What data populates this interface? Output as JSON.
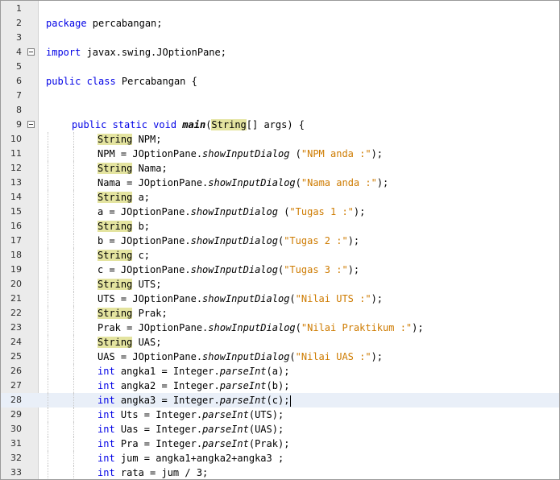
{
  "editor": {
    "lines": [
      {
        "no": "1",
        "fold": false,
        "indent": 0,
        "tokens": []
      },
      {
        "no": "2",
        "fold": false,
        "indent": 0,
        "tokens": [
          {
            "t": "package",
            "c": "kw"
          },
          {
            "t": " percabangan;",
            "c": ""
          }
        ]
      },
      {
        "no": "3",
        "fold": false,
        "indent": 0,
        "tokens": []
      },
      {
        "no": "4",
        "fold": true,
        "indent": 0,
        "tokens": [
          {
            "t": "import",
            "c": "kw"
          },
          {
            "t": " javax.swing.JOptionPane;",
            "c": ""
          }
        ]
      },
      {
        "no": "5",
        "fold": false,
        "indent": 0,
        "tokens": []
      },
      {
        "no": "6",
        "fold": false,
        "indent": 0,
        "tokens": [
          {
            "t": "public class",
            "c": "kw"
          },
          {
            "t": " Percabangan {",
            "c": ""
          }
        ]
      },
      {
        "no": "7",
        "fold": false,
        "indent": 0,
        "tokens": []
      },
      {
        "no": "8",
        "fold": false,
        "indent": 0,
        "tokens": []
      },
      {
        "no": "9",
        "fold": true,
        "indent": 1,
        "tokens": [
          {
            "t": "public static void",
            "c": "kw"
          },
          {
            "t": " ",
            "c": ""
          },
          {
            "t": "main",
            "c": "bi"
          },
          {
            "t": "(",
            "c": ""
          },
          {
            "t": "String",
            "c": "hl-type"
          },
          {
            "t": "[] args) {",
            "c": ""
          }
        ]
      },
      {
        "no": "10",
        "fold": false,
        "indent": 2,
        "tokens": [
          {
            "t": "String",
            "c": "hl-type"
          },
          {
            "t": " NPM;",
            "c": ""
          }
        ]
      },
      {
        "no": "11",
        "fold": false,
        "indent": 2,
        "tokens": [
          {
            "t": "NPM = JOptionPane.",
            "c": ""
          },
          {
            "t": "showInputDialog",
            "c": "it"
          },
          {
            "t": " (",
            "c": ""
          },
          {
            "t": "\"NPM anda :\"",
            "c": "str"
          },
          {
            "t": ");",
            "c": ""
          }
        ]
      },
      {
        "no": "12",
        "fold": false,
        "indent": 2,
        "tokens": [
          {
            "t": "String",
            "c": "hl-type"
          },
          {
            "t": " Nama;",
            "c": ""
          }
        ]
      },
      {
        "no": "13",
        "fold": false,
        "indent": 2,
        "tokens": [
          {
            "t": "Nama = JOptionPane.",
            "c": ""
          },
          {
            "t": "showInputDialog",
            "c": "it"
          },
          {
            "t": "(",
            "c": ""
          },
          {
            "t": "\"Nama anda :\"",
            "c": "str"
          },
          {
            "t": ");",
            "c": ""
          }
        ]
      },
      {
        "no": "14",
        "fold": false,
        "indent": 2,
        "tokens": [
          {
            "t": "String",
            "c": "hl-type"
          },
          {
            "t": " a;",
            "c": ""
          }
        ]
      },
      {
        "no": "15",
        "fold": false,
        "indent": 2,
        "tokens": [
          {
            "t": "a = JOptionPane.",
            "c": ""
          },
          {
            "t": "showInputDialog",
            "c": "it"
          },
          {
            "t": " (",
            "c": ""
          },
          {
            "t": "\"Tugas 1 :\"",
            "c": "str"
          },
          {
            "t": ");",
            "c": ""
          }
        ]
      },
      {
        "no": "16",
        "fold": false,
        "indent": 2,
        "tokens": [
          {
            "t": "String",
            "c": "hl-type"
          },
          {
            "t": " b;",
            "c": ""
          }
        ]
      },
      {
        "no": "17",
        "fold": false,
        "indent": 2,
        "tokens": [
          {
            "t": "b = JOptionPane.",
            "c": ""
          },
          {
            "t": "showInputDialog",
            "c": "it"
          },
          {
            "t": "(",
            "c": ""
          },
          {
            "t": "\"Tugas 2 :\"",
            "c": "str"
          },
          {
            "t": ");",
            "c": ""
          }
        ]
      },
      {
        "no": "18",
        "fold": false,
        "indent": 2,
        "tokens": [
          {
            "t": "String",
            "c": "hl-type"
          },
          {
            "t": " c;",
            "c": ""
          }
        ]
      },
      {
        "no": "19",
        "fold": false,
        "indent": 2,
        "tokens": [
          {
            "t": "c = JOptionPane.",
            "c": ""
          },
          {
            "t": "showInputDialog",
            "c": "it"
          },
          {
            "t": "(",
            "c": ""
          },
          {
            "t": "\"Tugas 3 :\"",
            "c": "str"
          },
          {
            "t": ");",
            "c": ""
          }
        ]
      },
      {
        "no": "20",
        "fold": false,
        "indent": 2,
        "tokens": [
          {
            "t": "String",
            "c": "hl-type"
          },
          {
            "t": " UTS;",
            "c": ""
          }
        ]
      },
      {
        "no": "21",
        "fold": false,
        "indent": 2,
        "tokens": [
          {
            "t": "UTS = JOptionPane.",
            "c": ""
          },
          {
            "t": "showInputDialog",
            "c": "it"
          },
          {
            "t": "(",
            "c": ""
          },
          {
            "t": "\"Nilai UTS :\"",
            "c": "str"
          },
          {
            "t": ");",
            "c": ""
          }
        ]
      },
      {
        "no": "22",
        "fold": false,
        "indent": 2,
        "tokens": [
          {
            "t": "String",
            "c": "hl-type"
          },
          {
            "t": " Prak;",
            "c": ""
          }
        ]
      },
      {
        "no": "23",
        "fold": false,
        "indent": 2,
        "tokens": [
          {
            "t": "Prak = JOptionPane.",
            "c": ""
          },
          {
            "t": "showInputDialog",
            "c": "it"
          },
          {
            "t": "(",
            "c": ""
          },
          {
            "t": "\"Nilai Praktikum :\"",
            "c": "str"
          },
          {
            "t": ");",
            "c": ""
          }
        ]
      },
      {
        "no": "24",
        "fold": false,
        "indent": 2,
        "tokens": [
          {
            "t": "String",
            "c": "hl-type"
          },
          {
            "t": " UAS;",
            "c": ""
          }
        ]
      },
      {
        "no": "25",
        "fold": false,
        "indent": 2,
        "tokens": [
          {
            "t": "UAS = JOptionPane.",
            "c": ""
          },
          {
            "t": "showInputDialog",
            "c": "it"
          },
          {
            "t": "(",
            "c": ""
          },
          {
            "t": "\"Nilai UAS :\"",
            "c": "str"
          },
          {
            "t": ");",
            "c": ""
          }
        ]
      },
      {
        "no": "26",
        "fold": false,
        "indent": 2,
        "tokens": [
          {
            "t": "int",
            "c": "kw"
          },
          {
            "t": " angka1 = Integer.",
            "c": ""
          },
          {
            "t": "parseInt",
            "c": "it"
          },
          {
            "t": "(a);",
            "c": ""
          }
        ]
      },
      {
        "no": "27",
        "fold": false,
        "indent": 2,
        "tokens": [
          {
            "t": "int",
            "c": "kw"
          },
          {
            "t": " angka2 = Integer.",
            "c": ""
          },
          {
            "t": "parseInt",
            "c": "it"
          },
          {
            "t": "(b);",
            "c": ""
          }
        ]
      },
      {
        "no": "28",
        "fold": false,
        "indent": 2,
        "current": true,
        "tokens": [
          {
            "t": "int",
            "c": "kw"
          },
          {
            "t": " angka3 = Integer.",
            "c": ""
          },
          {
            "t": "parseInt",
            "c": "it"
          },
          {
            "t": "(c);",
            "c": ""
          }
        ]
      },
      {
        "no": "29",
        "fold": false,
        "indent": 2,
        "tokens": [
          {
            "t": "int",
            "c": "kw"
          },
          {
            "t": " Uts = Integer.",
            "c": ""
          },
          {
            "t": "parseInt",
            "c": "it"
          },
          {
            "t": "(UTS);",
            "c": ""
          }
        ]
      },
      {
        "no": "30",
        "fold": false,
        "indent": 2,
        "tokens": [
          {
            "t": "int",
            "c": "kw"
          },
          {
            "t": " Uas = Integer.",
            "c": ""
          },
          {
            "t": "parseInt",
            "c": "it"
          },
          {
            "t": "(UAS);",
            "c": ""
          }
        ]
      },
      {
        "no": "31",
        "fold": false,
        "indent": 2,
        "tokens": [
          {
            "t": "int",
            "c": "kw"
          },
          {
            "t": " Pra = Integer.",
            "c": ""
          },
          {
            "t": "parseInt",
            "c": "it"
          },
          {
            "t": "(Prak);",
            "c": ""
          }
        ]
      },
      {
        "no": "32",
        "fold": false,
        "indent": 2,
        "tokens": [
          {
            "t": "int",
            "c": "kw"
          },
          {
            "t": " jum = angka1+angka2+angka3 ;",
            "c": ""
          }
        ]
      },
      {
        "no": "33",
        "fold": false,
        "indent": 2,
        "tokens": [
          {
            "t": "int",
            "c": "kw"
          },
          {
            "t": " rata = jum / 3;",
            "c": ""
          }
        ]
      }
    ]
  },
  "colors": {
    "keyword": "#0000e6",
    "string": "#ce7b00",
    "type_highlight": "#e4e4a0",
    "current_line": "#e9eff8",
    "gutter": "#ebebeb"
  },
  "icons": {
    "fold": "fold-toggle-icon"
  }
}
